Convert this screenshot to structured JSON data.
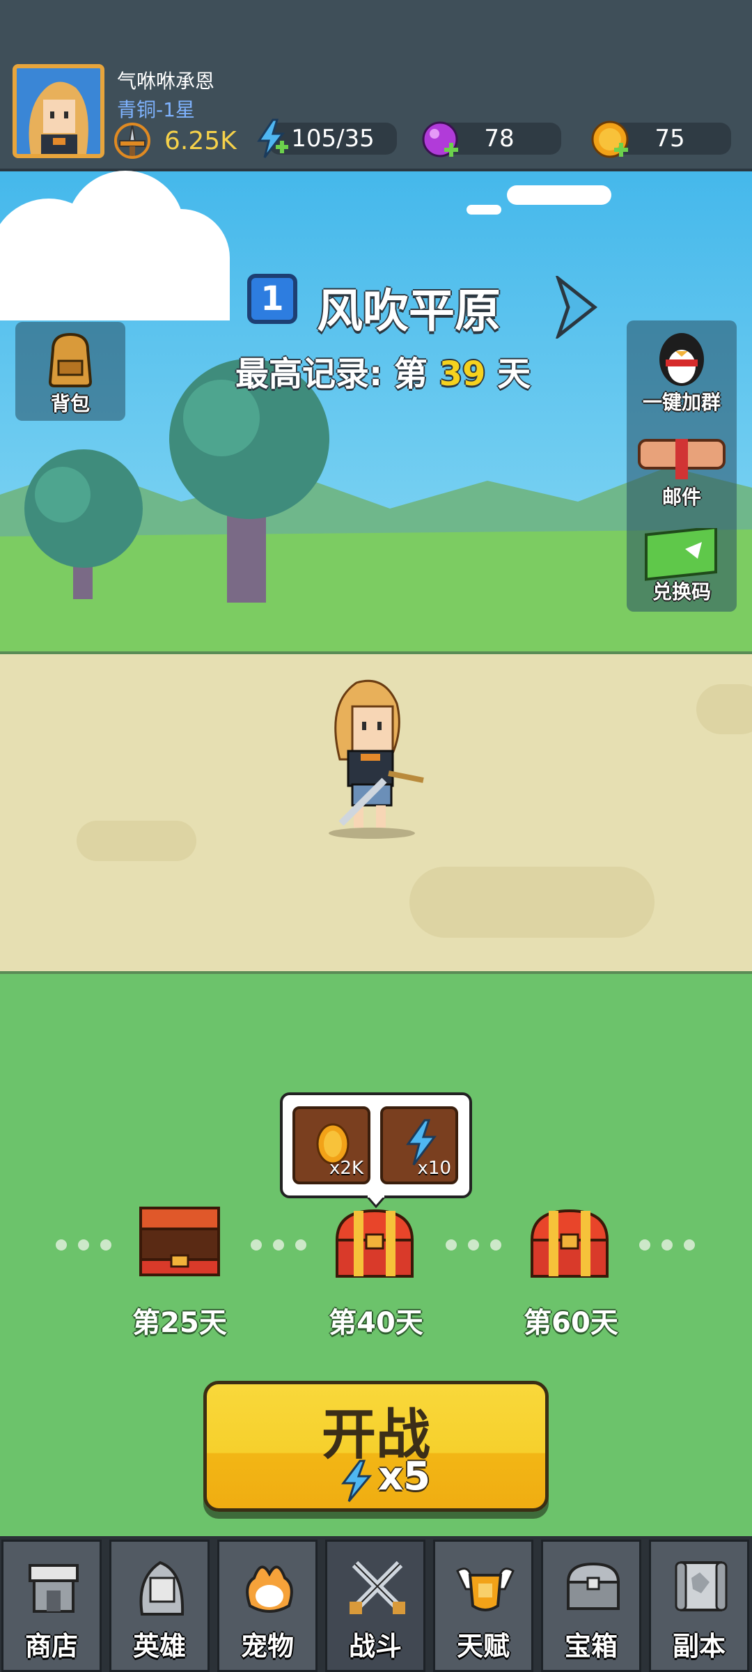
{
  "player": {
    "name": "气咻咻承恩",
    "rank": "青铜-1星",
    "power": "6.25K"
  },
  "resources": {
    "energy": "105/35",
    "gems": "78",
    "coins": "75"
  },
  "stage": {
    "number": "1",
    "name": "风吹平原",
    "record_prefix": "最高记录: 第",
    "record_days": "39",
    "record_suffix": "天"
  },
  "side_buttons": {
    "backpack": "背包",
    "join_group": "一键加群",
    "mail": "邮件",
    "redeem": "兑换码"
  },
  "rewards": {
    "milestones": [
      {
        "label": "第25天",
        "state": "opened"
      },
      {
        "label": "第40天",
        "state": "locked"
      },
      {
        "label": "第60天",
        "state": "locked"
      }
    ],
    "tooltip_items": [
      {
        "icon": "coin-icon",
        "count": "x2K"
      },
      {
        "icon": "energy-icon",
        "count": "x10"
      }
    ]
  },
  "battle_button": {
    "label": "开战",
    "cost": "x5"
  },
  "nav": {
    "items": [
      {
        "label": "商店",
        "icon": "shop-icon"
      },
      {
        "label": "英雄",
        "icon": "hero-icon"
      },
      {
        "label": "宠物",
        "icon": "pet-icon"
      },
      {
        "label": "战斗",
        "icon": "battle-icon"
      },
      {
        "label": "天赋",
        "icon": "talent-icon"
      },
      {
        "label": "宝箱",
        "icon": "chest-icon"
      },
      {
        "label": "副本",
        "icon": "dungeon-icon"
      }
    ],
    "active": "战斗"
  },
  "colors": {
    "topbar": "#3f4f59",
    "grass": "#6cc36b",
    "road": "#e6dfb2",
    "accent_yellow": "#f6d21e"
  }
}
